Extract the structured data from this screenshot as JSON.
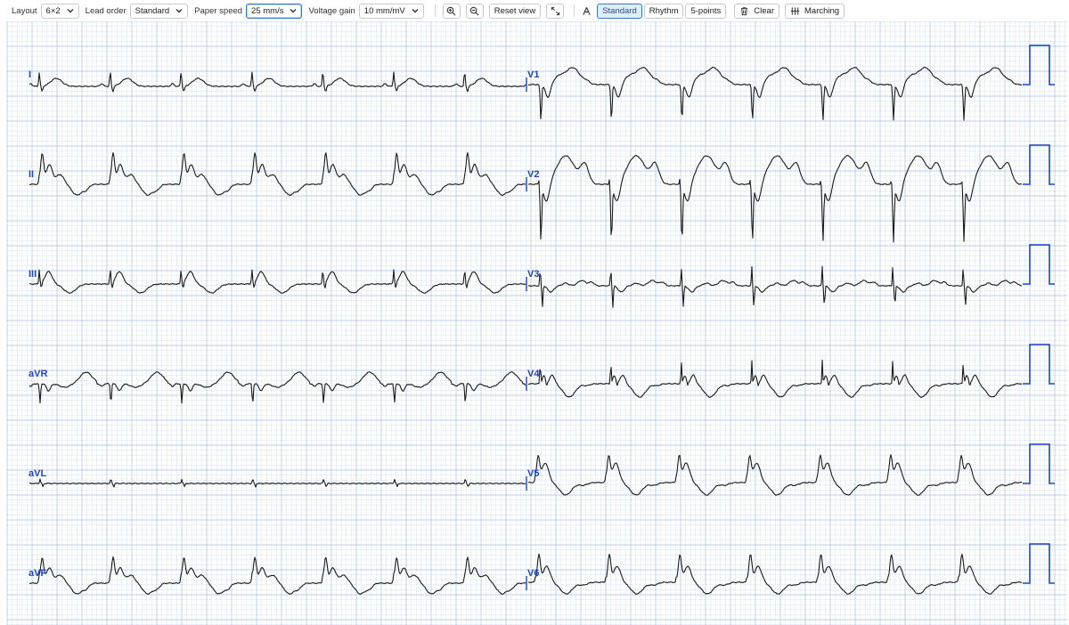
{
  "toolbar": {
    "layout_label": "Layout",
    "layout_value": "6×2",
    "lead_order_label": "Lead order",
    "lead_order_value": "Standard",
    "paper_speed_label": "Paper speed",
    "paper_speed_value": "25 mm/s",
    "voltage_gain_label": "Voltage gain",
    "voltage_gain_value": "10 mm/mV",
    "zoom_in_icon": "zoom-in-icon",
    "zoom_out_icon": "zoom-out-icon",
    "reset_view_label": "Reset view",
    "fit_icon": "expand-icon",
    "measure_icon": "caliper-icon",
    "modes": [
      "Standard",
      "Rhythm",
      "5-points"
    ],
    "active_mode": "Standard",
    "clear_label": "Clear",
    "marching_label": "Marching"
  },
  "ecg": {
    "grid_minor_color": "#d4e2f3",
    "grid_major_color": "#a9c3e3",
    "trace_color": "#1a1a1a",
    "label_color": "#1d47c2",
    "calibration_color": "#1d47c2",
    "left_leads": [
      "I",
      "II",
      "III",
      "aVR",
      "aVL",
      "aVF"
    ],
    "right_leads": [
      "V1",
      "V2",
      "V3",
      "V4",
      "V5",
      "V6"
    ],
    "beats_per_row": 7
  }
}
